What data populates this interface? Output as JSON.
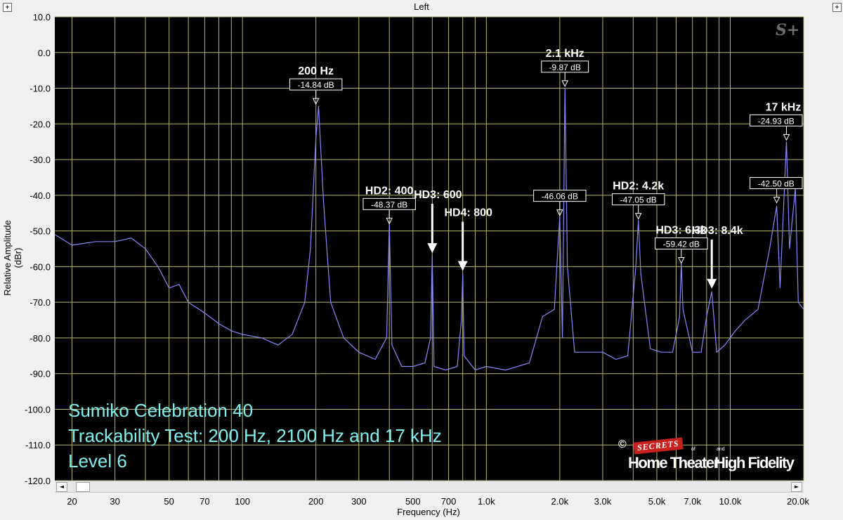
{
  "window": {
    "title": "Left",
    "restore_glyph": "+"
  },
  "scroll": {
    "left_arrow": "◄",
    "right_arrow": "►"
  },
  "overlay": {
    "line1": "Sumiko Celebration 40",
    "line2": "Trackability Test: 200 Hz, 2100 Hz and 17 kHz",
    "line3": "Level 6"
  },
  "logo": {
    "copyright": "©",
    "secrets": "SECRETS",
    "of": "of",
    "and": "and",
    "home_theater": "Home Theater",
    "high_fidelity": "High Fidelity"
  },
  "brand_mark": "S+",
  "colors": {
    "plot_bg": "#000000",
    "grid": "#b4b46a",
    "trace": "#8888ff",
    "annotation": "#ffffff",
    "overlay_text": "#7ff0f0",
    "logo_red": "#c8201e"
  },
  "chart_data": {
    "type": "line",
    "title": "Left",
    "xlabel": "Frequency (Hz)",
    "ylabel": "Relative Amplitude (dBr)",
    "x_scale": "log",
    "xlim": [
      17,
      20000
    ],
    "ylim": [
      -120,
      10
    ],
    "grid": true,
    "y_ticks": [
      10,
      0,
      -10,
      -20,
      -30,
      -40,
      -50,
      -60,
      -70,
      -80,
      -90,
      -100,
      -110,
      -120
    ],
    "y_tick_labels": [
      "10.0",
      "0.0",
      "-10.0",
      "-20.0",
      "-30.0",
      "-40.0",
      "-50.0",
      "-60.0",
      "-70.0",
      "-80.0",
      "-90.0",
      "-100.0",
      "-110.0",
      "-120.0"
    ],
    "x_ticks": [
      20,
      30,
      50,
      70,
      100,
      200,
      300,
      500,
      700,
      1000,
      2000,
      3000,
      5000,
      7000,
      10000,
      20000
    ],
    "x_tick_labels": [
      "20",
      "30",
      "50",
      "70",
      "100",
      "200",
      "300",
      "500",
      "700",
      "1.0k",
      "2.0k",
      "3.0k",
      "5.0k",
      "7.0k",
      "10.0k",
      "20.0k"
    ],
    "series": [
      {
        "x": [
          17,
          20,
          25,
          30,
          35,
          40,
          45,
          50,
          55,
          60,
          70,
          80,
          90,
          100,
          120,
          140,
          160,
          180,
          190,
          200,
          205,
          215,
          230,
          260,
          300,
          350,
          390,
          400,
          410,
          450,
          500,
          560,
          590,
          600,
          610,
          680,
          760,
          790,
          800,
          810,
          900,
          1000,
          1200,
          1500,
          1700,
          1900,
          2000,
          2050,
          2100,
          2150,
          2300,
          2600,
          3000,
          3400,
          3800,
          4100,
          4200,
          4300,
          4700,
          5200,
          5800,
          6200,
          6300,
          6400,
          7000,
          7600,
          8000,
          8400,
          8800,
          9500,
          10500,
          11500,
          13000,
          14500,
          15500,
          16000,
          17000,
          17500,
          18500,
          19000,
          20000
        ],
        "y": [
          -51,
          -54,
          -53,
          -53,
          -52,
          -55,
          -60,
          -66,
          -65,
          -70,
          -73,
          -76,
          -78,
          -79,
          -80,
          -82,
          -79,
          -70,
          -55,
          -24,
          -15,
          -42,
          -70,
          -80,
          -84,
          -86,
          -80,
          -48,
          -82,
          -88,
          -88,
          -87,
          -80,
          -57,
          -88,
          -89,
          -88,
          -75,
          -62,
          -85,
          -89,
          -88,
          -89,
          -87,
          -74,
          -72,
          -46,
          -80,
          -10,
          -60,
          -84,
          -84,
          -84,
          -86,
          -85,
          -60,
          -47,
          -62,
          -83,
          -84,
          -84,
          -74,
          -59,
          -72,
          -84,
          -84,
          -74,
          -67,
          -84,
          -82,
          -78,
          -75,
          -72,
          -55,
          -43,
          -66,
          -25,
          -55,
          -38,
          -70,
          -72
        ]
      }
    ],
    "annotations": [
      {
        "label": "200 Hz",
        "value": "-14.84 dB",
        "x": 200,
        "y": -14.84
      },
      {
        "label": "HD2: 400",
        "value": "-48.37 dB",
        "x": 400,
        "y": -48.37
      },
      {
        "label": "HD3: 600",
        "x": 600,
        "y": -57
      },
      {
        "label": "HD4: 800",
        "x": 800,
        "y": -62
      },
      {
        "label": "2.1 kHz",
        "value": "-9.87 dB",
        "x": 2100,
        "y": -9.87
      },
      {
        "value": "-46.06 dB",
        "x": 2000,
        "y": -46.06
      },
      {
        "label": "HD2: 4.2k",
        "value": "-47.05 dB",
        "x": 4200,
        "y": -47.05
      },
      {
        "label": "HD3: 6.3k",
        "value": "-59.42 dB",
        "x": 6300,
        "y": -59.42
      },
      {
        "label": "HD3: 8.4k",
        "x": 8400,
        "y": -67
      },
      {
        "value": "-42.50 dB",
        "x": 15500,
        "y": -42.5
      },
      {
        "label": "17 kHz",
        "value": "-24.93 dB",
        "x": 17000,
        "y": -24.93
      }
    ]
  }
}
